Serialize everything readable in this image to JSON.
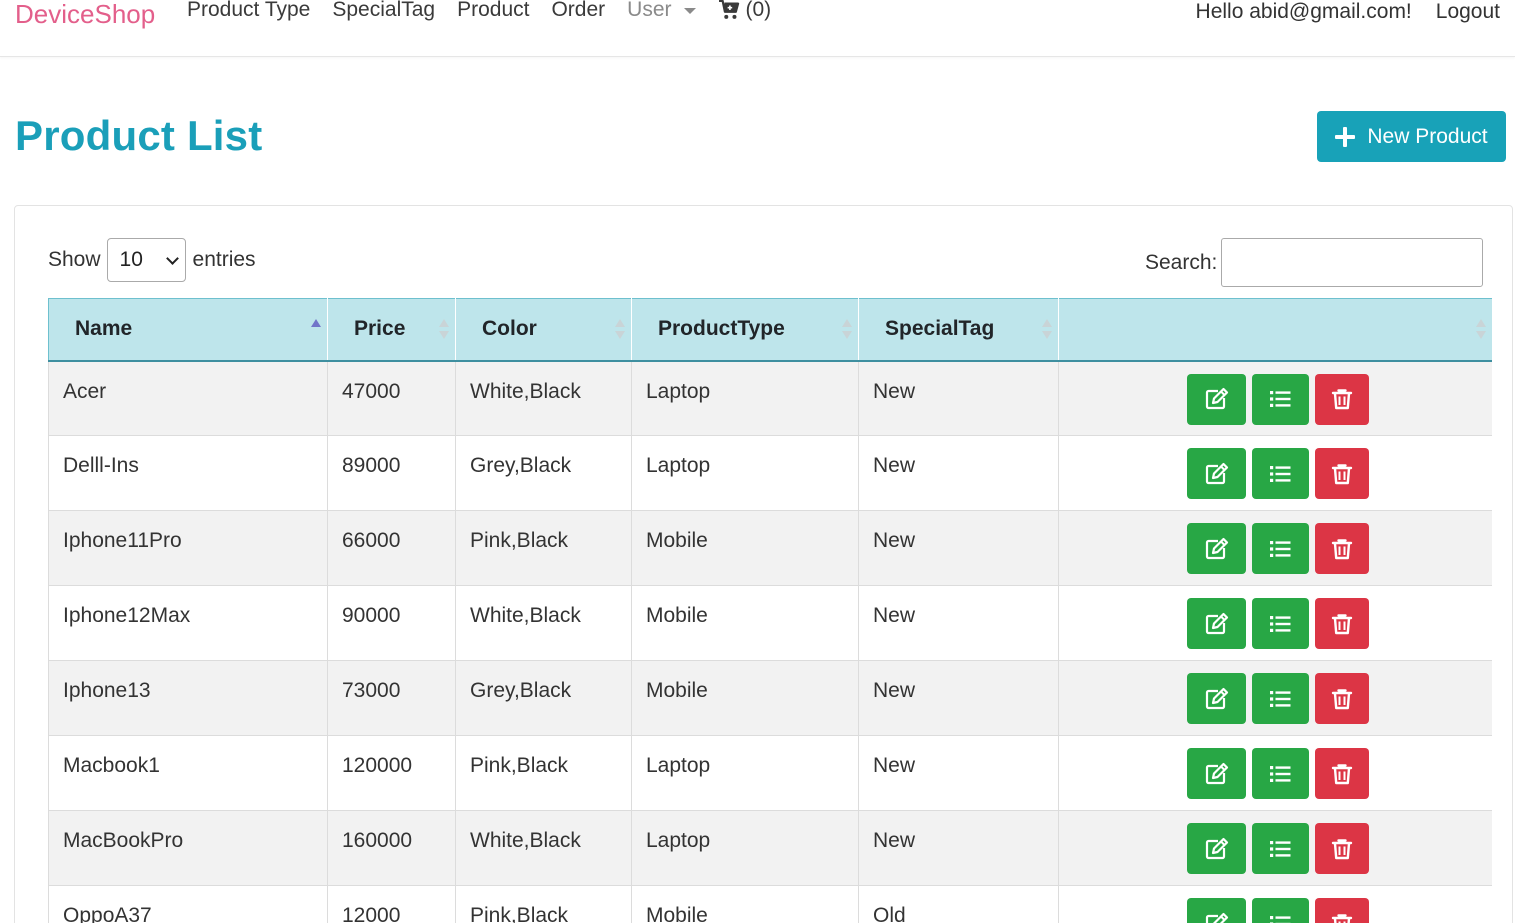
{
  "nav": {
    "brand": "DeviceShop",
    "links": [
      "Product Type",
      "SpecialTag",
      "Product",
      "Order"
    ],
    "user_menu": "User",
    "cart_count": "(0)",
    "greeting": "Hello abid@gmail.com!",
    "logout": "Logout"
  },
  "page": {
    "title": "Product List",
    "new_button": "New Product"
  },
  "table_controls": {
    "show_label": "Show",
    "entries_value": "10",
    "entries_label": "entries",
    "search_label": "Search:",
    "search_value": ""
  },
  "table": {
    "columns": [
      "Name",
      "Price",
      "Color",
      "ProductType",
      "SpecialTag",
      ""
    ],
    "rows": [
      {
        "name": "Acer",
        "price": "47000",
        "color": "White,Black",
        "type": "Laptop",
        "tag": "New"
      },
      {
        "name": "Delll-Ins",
        "price": "89000",
        "color": "Grey,Black",
        "type": "Laptop",
        "tag": "New"
      },
      {
        "name": "Iphone11Pro",
        "price": "66000",
        "color": "Pink,Black",
        "type": "Mobile",
        "tag": "New"
      },
      {
        "name": "Iphone12Max",
        "price": "90000",
        "color": "White,Black",
        "type": "Mobile",
        "tag": "New"
      },
      {
        "name": "Iphone13",
        "price": "73000",
        "color": "Grey,Black",
        "type": "Mobile",
        "tag": "New"
      },
      {
        "name": "Macbook1",
        "price": "120000",
        "color": "Pink,Black",
        "type": "Laptop",
        "tag": "New"
      },
      {
        "name": "MacBookPro",
        "price": "160000",
        "color": "White,Black",
        "type": "Laptop",
        "tag": "New"
      },
      {
        "name": "OppoA37",
        "price": "12000",
        "color": "Pink,Black",
        "type": "Mobile",
        "tag": "Old"
      }
    ]
  },
  "icons": {
    "edit": "edit-icon",
    "details": "list-icon",
    "delete": "trash-icon",
    "cart": "cart-icon",
    "add": "plus-icon"
  },
  "colors": {
    "brand": "#e35f8b",
    "title": "#1a9fb9",
    "primary_button": "#18a2b8",
    "success": "#28a745",
    "danger": "#dc3545",
    "table_header": "#bee5eb"
  }
}
